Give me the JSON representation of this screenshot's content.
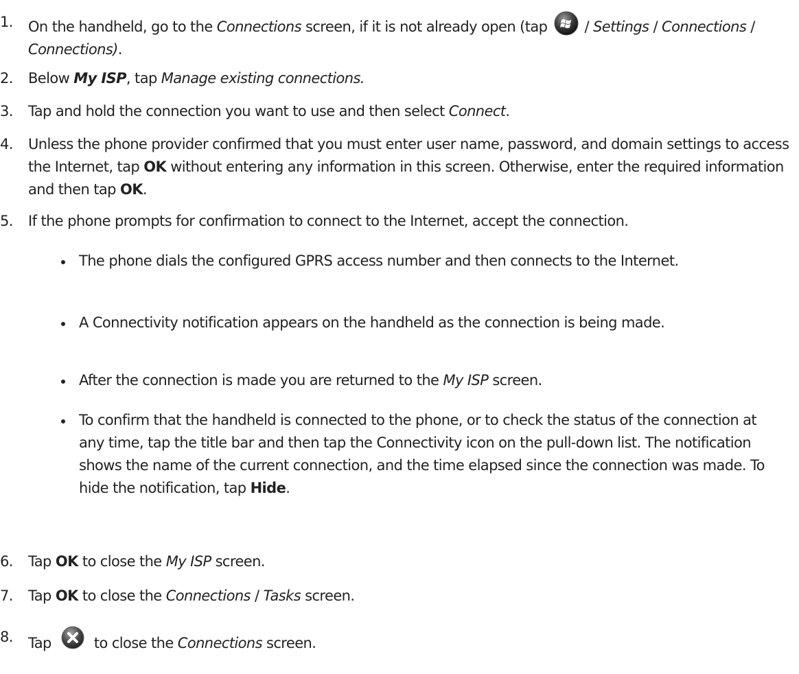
{
  "steps": [
    {
      "num": "1.",
      "parts": {
        "a": "On the handheld, go to the ",
        "b": "Connections",
        "c": " screen, if it is not already open (tap ",
        "d": " / ",
        "e": "Settings",
        "f": " / ",
        "g": "Connections",
        "h": " / ",
        "i": "Connections)",
        "j": "."
      }
    },
    {
      "num": "2.",
      "parts": {
        "a": "Below ",
        "b": "My ISP",
        "c": ", tap ",
        "d": "Manage existing connections."
      }
    },
    {
      "num": "3.",
      "parts": {
        "a": "Tap and hold the connection you want to use and then select ",
        "b": "Connect",
        "c": "."
      }
    },
    {
      "num": "4.",
      "parts": {
        "a": "Unless the phone provider confirmed that you must enter user name, password, and domain settings to access the Internet, tap ",
        "b": "OK",
        "c": " without entering any information in this screen. Otherwise, enter the required information and then tap ",
        "d": "OK",
        "e": "."
      }
    },
    {
      "num": "5.",
      "parts": {
        "a": "If the phone prompts for confirmation to connect to the Internet, accept the connection."
      }
    },
    {
      "num": "6.",
      "parts": {
        "a": "Tap ",
        "b": "OK",
        "c": " to close the ",
        "d": "My ISP",
        "e": " screen."
      }
    },
    {
      "num": "7.",
      "parts": {
        "a": "Tap ",
        "b": "OK",
        "c": " to close the ",
        "d": "Connections",
        "e": " / ",
        "f": "Tasks",
        "g": " screen."
      }
    },
    {
      "num": "8.",
      "parts": {
        "a": "Tap ",
        "b": " to close the ",
        "c": "Connections",
        "d": " screen."
      }
    }
  ],
  "bullets": {
    "b1": "The phone dials the configured GPRS access number and then connects to the Internet.",
    "b2": "A Connectivity notification appears on the handheld as the connection is being made.",
    "b3": {
      "a": "After the connection is made you are returned to the ",
      "b": "My ISP",
      "c": " screen."
    },
    "b4": {
      "a": "To confirm that the handheld is connected to the phone, or to check the status of the connection at any time, tap the title bar and then tap the Connectivity icon on the pull-down list. The notification shows the name of the current connection, and the time elapsed since the connection was made. To hide the notification, tap ",
      "b": "Hide",
      "c": "."
    }
  },
  "icons": {
    "start": "windows-start-orb-icon",
    "close": "close-x-icon"
  }
}
